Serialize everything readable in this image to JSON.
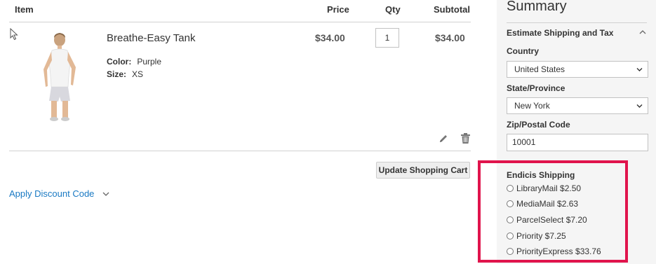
{
  "cart": {
    "headers": {
      "item": "Item",
      "price": "Price",
      "qty": "Qty",
      "subtotal": "Subtotal"
    },
    "item": {
      "name": "Breathe-Easy Tank",
      "options": [
        {
          "label": "Color:",
          "value": "Purple"
        },
        {
          "label": "Size:",
          "value": "XS"
        }
      ],
      "price": "$34.00",
      "qty": "1",
      "subtotal": "$34.00"
    },
    "update_label": "Update Shopping Cart",
    "discount_label": "Apply Discount Code"
  },
  "summary": {
    "title": "Summary",
    "estimate_label": "Estimate Shipping and Tax",
    "country_label": "Country",
    "country_value": "United States",
    "state_label": "State/Province",
    "state_value": "New York",
    "zip_label": "Zip/Postal Code",
    "zip_value": "10001",
    "shipping_carrier": "Endicis Shipping",
    "rates": [
      {
        "label": "LibraryMail $2.50"
      },
      {
        "label": "MediaMail $2.63"
      },
      {
        "label": "ParcelSelect $7.20"
      },
      {
        "label": "Priority $7.25"
      },
      {
        "label": "PriorityExpress $33.76"
      }
    ]
  },
  "colors": {
    "link": "#1979c3",
    "highlight": "#e0144c",
    "summary_bg": "#f5f5f5"
  },
  "icons": [
    "cursor-icon",
    "edit-icon",
    "trash-icon",
    "chevron-down-icon",
    "chevron-up-icon"
  ]
}
